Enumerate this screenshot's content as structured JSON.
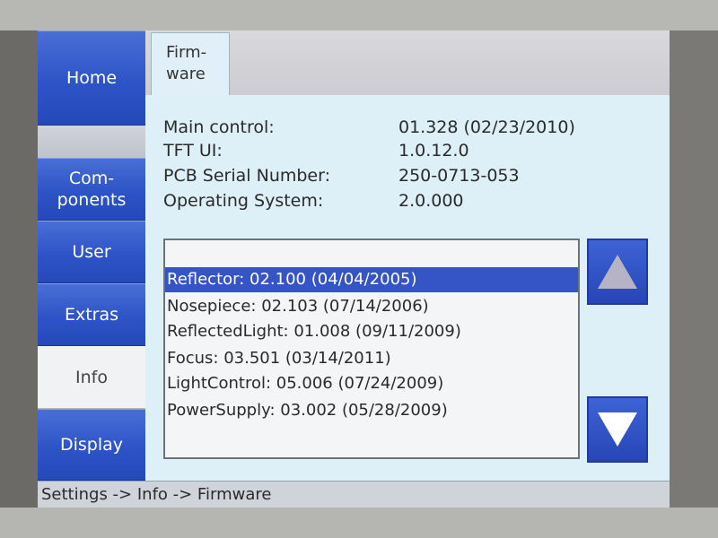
{
  "nav": {
    "home": "Home",
    "components": "Com-\nponents",
    "user": "User",
    "extras": "Extras",
    "info": "Info",
    "display": "Display"
  },
  "tab": {
    "label": "Firm-\nware"
  },
  "info": {
    "main_label": "Main control:",
    "main_value": "01.328 (02/23/2010)",
    "tft_label": "TFT UI:",
    "tft_value": "1.0.12.0",
    "pcb_label": "PCB Serial Number:",
    "pcb_value": "250-0713-053",
    "os_label": "Operating System:",
    "os_value": "2.0.000"
  },
  "list": {
    "items": [
      "Reflector: 02.100 (04/04/2005)",
      "Nosepiece: 02.103 (07/14/2006)",
      "ReflectedLight: 01.008 (09/11/2009)",
      "Focus: 03.501 (03/14/2011)",
      "LightControl: 05.006 (07/24/2009)",
      "PowerSupply: 03.002 (05/28/2009)"
    ],
    "selected_index": 0
  },
  "status": {
    "breadcrumb": "Settings -> Info -> Firmware"
  },
  "colors": {
    "nav_blue": "#2d54c7",
    "selection_blue": "#3555c7",
    "panel_bg": "#ddeff7"
  },
  "icons": {
    "scroll_up": "up-arrow-icon",
    "scroll_down": "down-arrow-icon"
  }
}
